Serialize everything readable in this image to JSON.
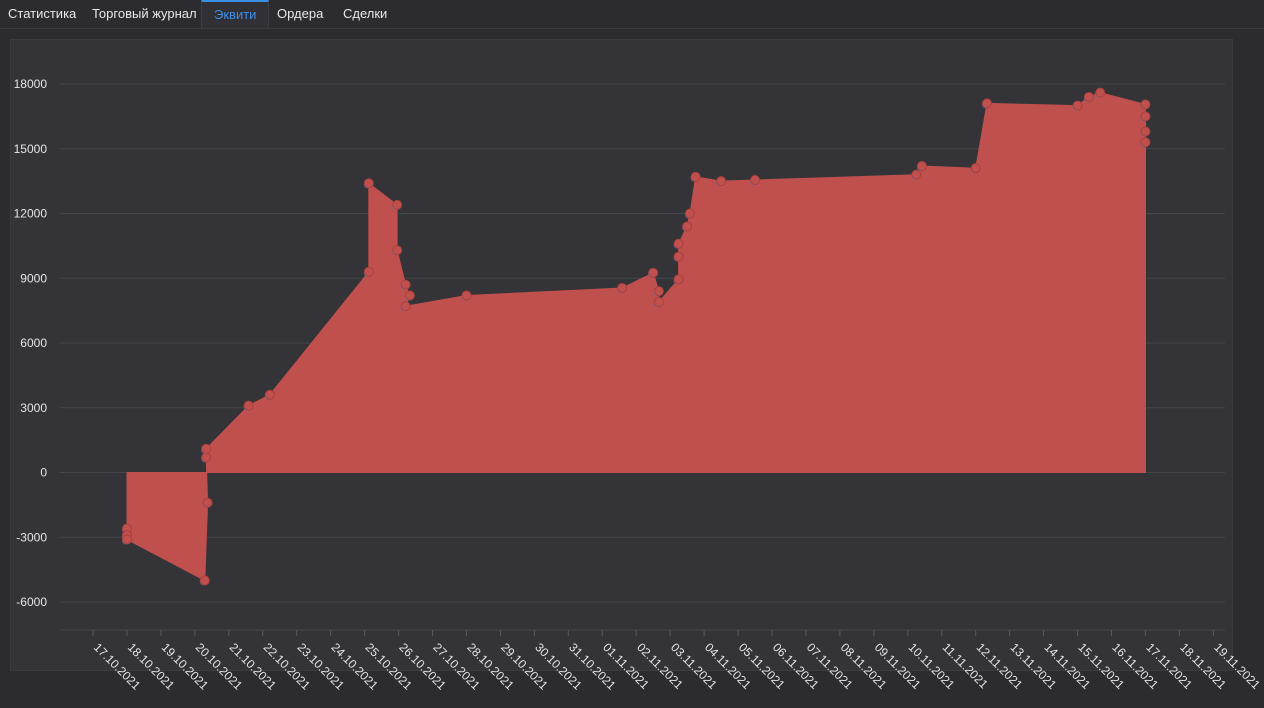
{
  "tabs": [
    {
      "label": "Статистика",
      "active": false
    },
    {
      "label": "Торговый журнал",
      "active": false
    },
    {
      "label": "Эквити",
      "active": true
    },
    {
      "label": "Ордера",
      "active": false
    },
    {
      "label": "Сделки",
      "active": false
    }
  ],
  "colors": {
    "area": "#c0504d",
    "marker": "#c0504d",
    "marker_secondary": "#4f81bd",
    "accent": "#3a8ee6"
  },
  "chart_data": {
    "type": "area",
    "title": "",
    "xlabel": "",
    "ylabel": "",
    "ylim": [
      -7000,
      19200
    ],
    "yticks": [
      -6000,
      -3000,
      0,
      3000,
      6000,
      9000,
      12000,
      15000,
      18000
    ],
    "xticks": [
      "17.10.2021",
      "18.10.2021",
      "19.10.2021",
      "20.10.2021",
      "21.10.2021",
      "22.10.2021",
      "23.10.2021",
      "24.10.2021",
      "25.10.2021",
      "26.10.2021",
      "27.10.2021",
      "28.10.2021",
      "29.10.2021",
      "30.10.2021",
      "31.10.2021",
      "01.11.2021",
      "02.11.2021",
      "03.11.2021",
      "04.11.2021",
      "05.11.2021",
      "06.11.2021",
      "07.11.2021",
      "08.11.2021",
      "09.11.2021",
      "10.11.2021",
      "11.11.2021",
      "12.11.2021",
      "13.11.2021",
      "14.11.2021",
      "15.11.2021",
      "16.11.2021",
      "17.11.2021",
      "18.11.2021",
      "19.11.2021"
    ],
    "grid": true,
    "series": [
      {
        "points": [
          {
            "x": "18.10.2021 00:00",
            "y": 0
          },
          {
            "x": "18.10.2021 00:00",
            "y": -2600
          },
          {
            "x": "18.10.2021 00:00",
            "y": -2900
          },
          {
            "x": "18.10.2021 00:00",
            "y": -3100
          },
          {
            "x": "20.10.2021 07:00",
            "y": -5000
          },
          {
            "x": "20.10.2021 09:00",
            "y": -1400
          },
          {
            "x": "20.10.2021 08:00",
            "y": 700
          },
          {
            "x": "20.10.2021 08:00",
            "y": 1100
          },
          {
            "x": "21.10.2021 14:00",
            "y": 3100
          },
          {
            "x": "22.10.2021 05:00",
            "y": 3600
          },
          {
            "x": "25.10.2021 03:00",
            "y": 9300
          },
          {
            "x": "25.10.2021 03:00",
            "y": 13400
          },
          {
            "x": "25.10.2021 23:00",
            "y": 12400
          },
          {
            "x": "25.10.2021 23:00",
            "y": 10300
          },
          {
            "x": "26.10.2021 05:00",
            "y": 8700
          },
          {
            "x": "26.10.2021 08:00",
            "y": 8200
          },
          {
            "x": "26.10.2021 05:00",
            "y": 7700
          },
          {
            "x": "28.10.2021 00:00",
            "y": 8200
          },
          {
            "x": "01.11.2021 14:00",
            "y": 8550
          },
          {
            "x": "02.11.2021 12:00",
            "y": 9250
          },
          {
            "x": "02.11.2021 16:00",
            "y": 8400
          },
          {
            "x": "02.11.2021 16:00",
            "y": 7900
          },
          {
            "x": "03.11.2021 06:00",
            "y": 8950
          },
          {
            "x": "03.11.2021 06:00",
            "y": 10000
          },
          {
            "x": "03.11.2021 06:00",
            "y": 10600
          },
          {
            "x": "03.11.2021 12:00",
            "y": 11400
          },
          {
            "x": "03.11.2021 14:00",
            "y": 12000
          },
          {
            "x": "03.11.2021 18:00",
            "y": 13700
          },
          {
            "x": "04.11.2021 12:00",
            "y": 13500
          },
          {
            "x": "05.11.2021 12:00",
            "y": 13550
          },
          {
            "x": "10.11.2021 06:00",
            "y": 13800
          },
          {
            "x": "10.11.2021 10:00",
            "y": 14200
          },
          {
            "x": "12.11.2021 00:00",
            "y": 14100
          },
          {
            "x": "12.11.2021 08:00",
            "y": 17100
          },
          {
            "x": "15.11.2021 00:00",
            "y": 17000
          },
          {
            "x": "15.11.2021 08:00",
            "y": 17400
          },
          {
            "x": "15.11.2021 16:00",
            "y": 17600
          },
          {
            "x": "17.11.2021 00:00",
            "y": 17050
          },
          {
            "x": "17.11.2021 00:00",
            "y": 16500
          },
          {
            "x": "17.11.2021 00:00",
            "y": 15800
          },
          {
            "x": "17.11.2021 00:00",
            "y": 15300
          },
          {
            "x": "17.11.2021 00:00",
            "y": 0
          }
        ]
      }
    ]
  }
}
